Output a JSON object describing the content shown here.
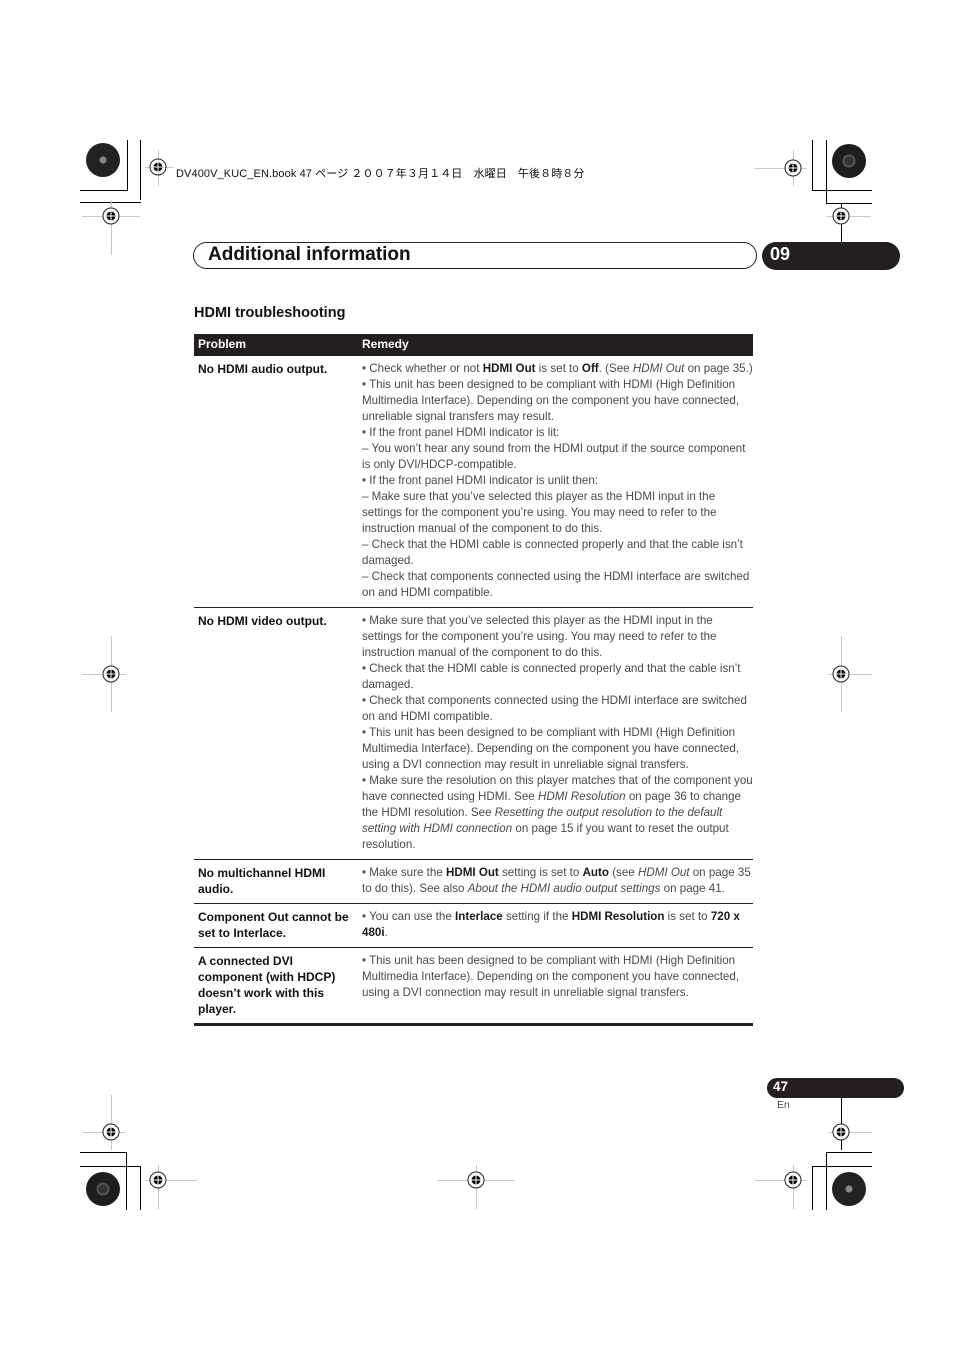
{
  "print_header": {
    "text": "DV400V_KUC_EN.book  47 ページ  ２００７年３月１４日　水曜日　午後８時８分"
  },
  "chapter": {
    "title": "Additional information",
    "number": "09"
  },
  "section": {
    "title": "HDMI troubleshooting"
  },
  "table": {
    "headers": {
      "problem": "Problem",
      "remedy": "Remedy"
    },
    "rows": [
      {
        "problem": "No HDMI audio output.",
        "remedy": [
          [
            {
              "t": "• Check whether or not "
            },
            {
              "t": "HDMI Out",
              "s": "b"
            },
            {
              "t": " is set to "
            },
            {
              "t": "Off",
              "s": "b"
            },
            {
              "t": ". (See "
            },
            {
              "t": "HDMI Out",
              "s": "i"
            },
            {
              "t": " on page 35.)"
            }
          ],
          [
            {
              "t": "• This unit has been designed to be compliant with HDMI (High Definition Multimedia Interface). Depending on the component you have connected, unreliable signal transfers may result."
            }
          ],
          [
            {
              "t": "• If the front panel HDMI indicator is lit:"
            }
          ],
          [
            {
              "t": "– You won’t hear any sound from the HDMI output if the source component is only DVI/HDCP-compatible."
            }
          ],
          [
            {
              "t": "• If the front panel HDMI indicator is unlit then:"
            }
          ],
          [
            {
              "t": "– Make sure that you’ve selected this player as the HDMI input in the settings for the component you’re using. You may need to refer to the instruction manual of the component to do this."
            }
          ],
          [
            {
              "t": "– Check that the HDMI cable is connected properly and that the cable isn’t damaged."
            }
          ],
          [
            {
              "t": "– Check that components connected using the HDMI interface are switched on and HDMI compatible."
            }
          ]
        ]
      },
      {
        "problem": "No HDMI video output.",
        "remedy": [
          [
            {
              "t": "• Make sure that you’ve selected this player as the HDMI input in the settings for the component you’re using. You may need to refer to the instruction manual of the component to do this."
            }
          ],
          [
            {
              "t": "• Check that the HDMI cable is connected properly and that the cable isn’t damaged."
            }
          ],
          [
            {
              "t": "• Check that components connected using the HDMI interface are switched on and HDMI compatible."
            }
          ],
          [
            {
              "t": "• This unit has been designed to be compliant with HDMI (High Definition Multimedia Interface). Depending on the component you have connected, using a DVI connection may result in unreliable signal transfers."
            }
          ],
          [
            {
              "t": "• Make sure the resolution on this player matches that of the component you have connected using HDMI. See "
            },
            {
              "t": "HDMI Resolution",
              "s": "i"
            },
            {
              "t": " on page 36 to change the HDMI resolution. See "
            },
            {
              "t": "Resetting the output resolution to the default setting with HDMI connection",
              "s": "i"
            },
            {
              "t": " on page 15 if you want to reset the output resolution."
            }
          ]
        ]
      },
      {
        "problem": "No multichannel HDMI audio.",
        "remedy": [
          [
            {
              "t": "• Make sure the "
            },
            {
              "t": "HDMI Out",
              "s": "b"
            },
            {
              "t": " setting is set to "
            },
            {
              "t": "Auto",
              "s": "b"
            },
            {
              "t": " (see "
            },
            {
              "t": "HDMI Out",
              "s": "i"
            },
            {
              "t": " on page 35 to do this). See also "
            },
            {
              "t": "About the HDMI audio output settings",
              "s": "i"
            },
            {
              "t": " on page 41."
            }
          ]
        ]
      },
      {
        "problem": "Component Out cannot be set to Interlace.",
        "remedy": [
          [
            {
              "t": "• You can use the "
            },
            {
              "t": "Interlace",
              "s": "b"
            },
            {
              "t": " setting if the "
            },
            {
              "t": "HDMI Resolution",
              "s": "b"
            },
            {
              "t": " is set to "
            },
            {
              "t": "720 x 480i",
              "s": "b"
            },
            {
              "t": "."
            }
          ]
        ]
      },
      {
        "problem": "A connected DVI component (with HDCP) doesn’t work with this player.",
        "remedy": [
          [
            {
              "t": "• This unit has been designed to be compliant with HDMI (High Definition Multimedia Interface). Depending on the component you have connected, using a DVI connection may result in unreliable signal transfers."
            }
          ]
        ]
      }
    ]
  },
  "footer": {
    "page_number": "47",
    "language": "En"
  },
  "colors": {
    "dark_fill": "#231f20",
    "body_text": "#4a4a4a"
  }
}
